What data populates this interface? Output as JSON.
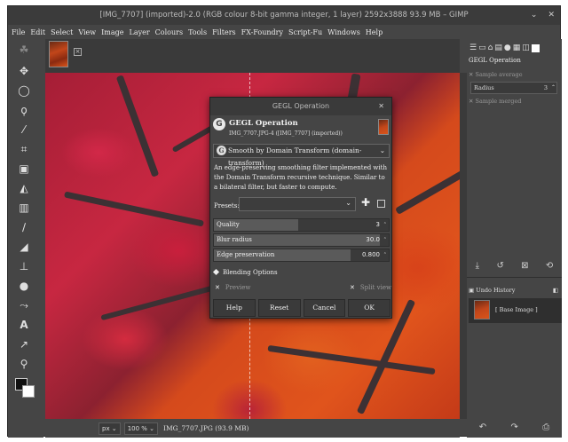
{
  "window": {
    "title": "[IMG_7707] (imported)-2.0 (RGB colour 8-bit gamma integer, 1 layer) 2592x3888 93.9 MB – GIMP",
    "minimize": "⌄",
    "close": "✕"
  },
  "menu": [
    "File",
    "Edit",
    "Select",
    "View",
    "Image",
    "Layer",
    "Colours",
    "Tools",
    "Filters",
    "FX-Foundry",
    "Script-Fu",
    "Windows",
    "Help"
  ],
  "statusbar": {
    "unit": "px ⌄",
    "zoom": "100 % ⌄",
    "info": "IMG_7707.JPG (93.9 MB)"
  },
  "dock": {
    "title": "GEGL Operation",
    "sample_average": "Sample average",
    "radius_label": "Radius",
    "radius_value": "3",
    "sample_merged": "Sample merged",
    "undo_title": "Undo History",
    "undo_item": "[ Base Image ]"
  },
  "dialog": {
    "title": "GEGL Operation",
    "heading": "GEGL Operation",
    "subheading": "IMG_7707.JPG-4 ([IMG_7707] (imported))",
    "operation": "Smooth by Domain Transform (domain-transform)",
    "description": "An edge-preserving smoothing filter implemented with the Domain Transform recursive technique. Similar to a bilateral filter, but faster to compute.",
    "presets_label": "Presets:",
    "params": [
      {
        "label": "Quality",
        "value": "3",
        "fraction": 0.48
      },
      {
        "label": "Blur radius",
        "value": "30.0",
        "fraction": 0.95
      },
      {
        "label": "Edge preservation",
        "value": "0.800",
        "fraction": 0.78
      }
    ],
    "blending": "Blending Options",
    "preview": "Preview",
    "split_view": "Split view",
    "buttons": {
      "help": "Help",
      "reset": "Reset",
      "cancel": "Cancel",
      "ok": "OK"
    }
  }
}
